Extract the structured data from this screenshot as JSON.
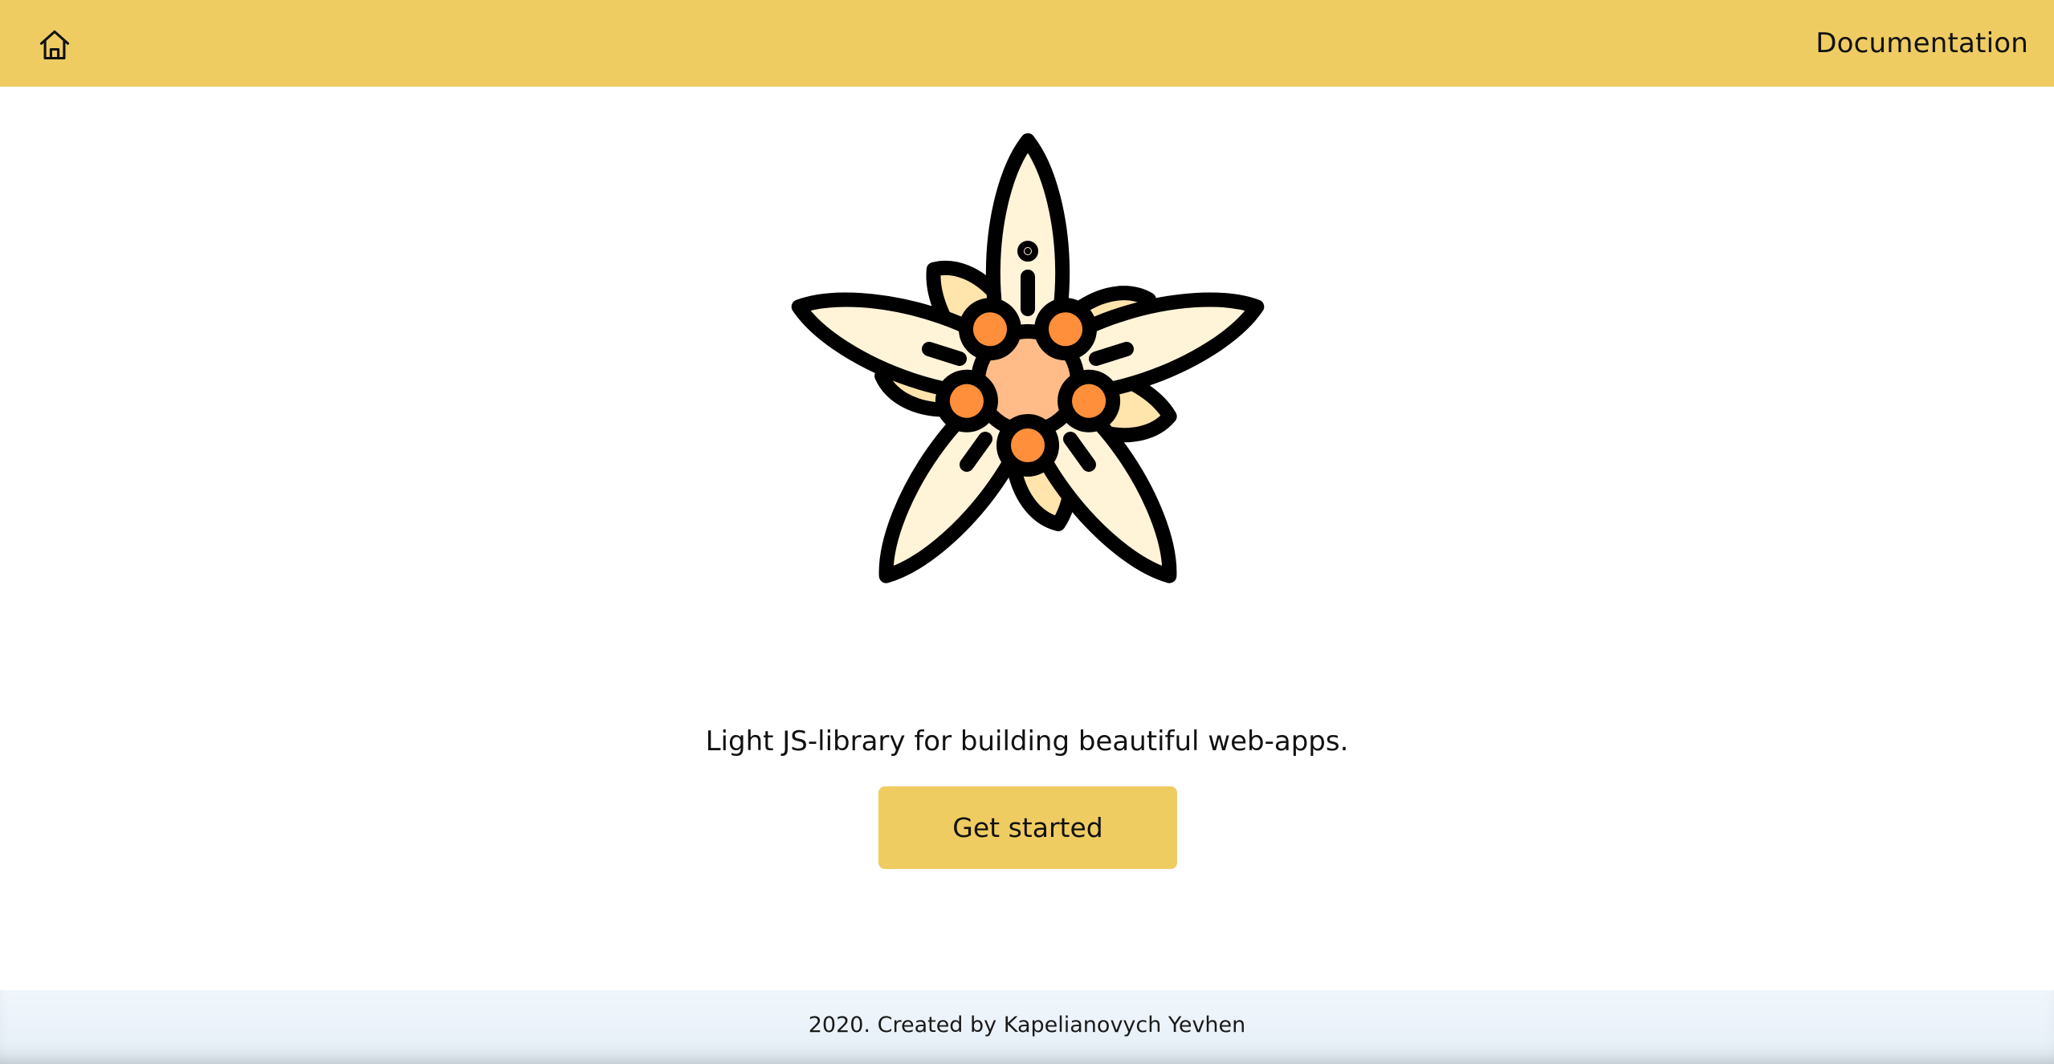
{
  "header": {
    "home_icon": "home-icon",
    "documentation_label": "Documentation"
  },
  "hero": {
    "logo_icon": "edelweiss-flower-icon",
    "tagline": "Light JS-library for building beautiful web-apps.",
    "cta_label": "Get started"
  },
  "footer": {
    "text": "2020. Created by Kapelianovych Yevhen"
  },
  "colors": {
    "accent": "#efcc62",
    "petal_light": "#fff3d8",
    "petal_mid": "#ffe4ac",
    "stamen": "#ff8f3a",
    "center": "#ffbb88"
  }
}
